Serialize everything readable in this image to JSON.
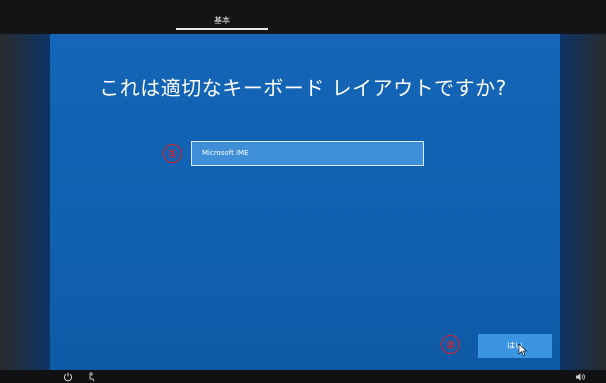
{
  "top_tab": {
    "label": "基本"
  },
  "main": {
    "title": "これは適切なキーボード レイアウトですか?",
    "keyboard_list": [
      {
        "label": "Microsoft IME",
        "selected": true
      }
    ]
  },
  "annotations": {
    "circle_1": "①",
    "circle_2": "②"
  },
  "footer": {
    "yes_label": "はい"
  },
  "icons": {
    "power": "power-icon",
    "accessibility": "accessibility-icon",
    "volume": "volume-icon",
    "cursor": "mouse-cursor-icon"
  },
  "colors": {
    "screen_blue": "#1565b8",
    "button_blue": "#3b95e0",
    "annotation_red": "#e02020"
  }
}
